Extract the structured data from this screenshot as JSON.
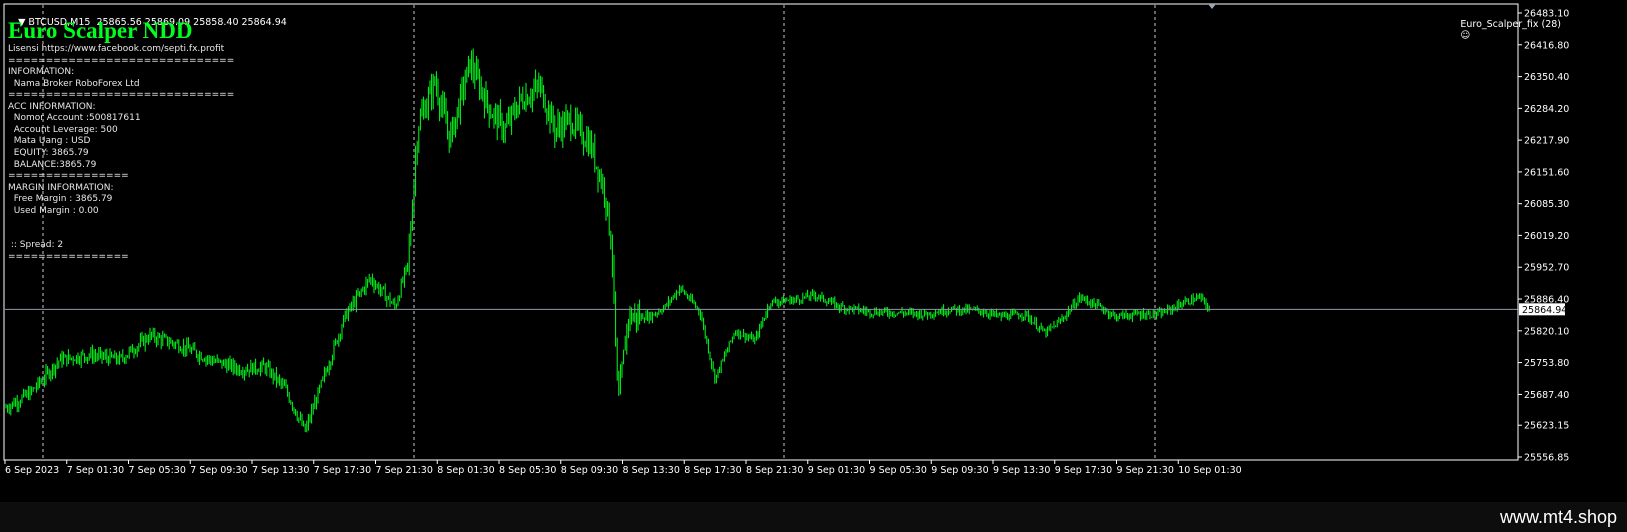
{
  "header": {
    "symbol_info": "BTCUSD,M15  25865.56 25869.09 25858.40 25864.94",
    "ea_label": "Euro_Scalper_fix (28)",
    "smile_icon": "smiley-icon"
  },
  "panel": {
    "title": "Euro Scalper NDD",
    "title_color": "#00ff1e",
    "lines": [
      "Lisensi https://www.facebook.com/septi.fx.profit",
      "==============================",
      "INFORMATION:",
      "  Nama Broker RoboForex Ltd",
      "==============================",
      "ACC INFORMATION:",
      "  Nomor Account :500817611",
      "  Account Leverage: 500",
      "  Mata Uang : USD",
      "  EQUITY: 3865.79",
      "  BALANCE:3865.79",
      "================",
      "MARGIN INFORMATION:",
      "  Free Margin : 3865.79",
      "  Used Margin : 0.00",
      "",
      "",
      " :: Spread: 2",
      "================"
    ]
  },
  "price_axis": {
    "labels": [
      "26483.10",
      "26416.80",
      "26350.40",
      "26284.20",
      "26217.90",
      "26151.60",
      "26085.30",
      "26019.20",
      "25952.70",
      "25886.40",
      "25820.10",
      "25753.80",
      "25687.40",
      "25623.15",
      "25556.85"
    ],
    "current_price": "25864.94"
  },
  "time_axis": {
    "labels": [
      "6 Sep 2023",
      "7 Sep 01:30",
      "7 Sep 05:30",
      "7 Sep 09:30",
      "7 Sep 13:30",
      "7 Sep 17:30",
      "7 Sep 21:30",
      "8 Sep 01:30",
      "8 Sep 05:30",
      "8 Sep 09:30",
      "8 Sep 13:30",
      "8 Sep 17:30",
      "8 Sep 21:30",
      "9 Sep 01:30",
      "9 Sep 05:30",
      "9 Sep 09:30",
      "9 Sep 13:30",
      "9 Sep 17:30",
      "9 Sep 21:30",
      "10 Sep 01:30"
    ]
  },
  "price_path": [
    [
      6,
      25660
    ],
    [
      30,
      25690
    ],
    [
      60,
      25760
    ],
    [
      90,
      25770
    ],
    [
      120,
      25760
    ],
    [
      150,
      25810
    ],
    [
      180,
      25790
    ],
    [
      210,
      25760
    ],
    [
      240,
      25740
    ],
    [
      265,
      25745
    ],
    [
      285,
      25700
    ],
    [
      305,
      25610
    ],
    [
      320,
      25700
    ],
    [
      345,
      25850
    ],
    [
      370,
      25930
    ],
    [
      395,
      25870
    ],
    [
      408,
      25960
    ],
    [
      418,
      26250
    ],
    [
      435,
      26340
    ],
    [
      450,
      26220
    ],
    [
      470,
      26380
    ],
    [
      490,
      26280
    ],
    [
      505,
      26240
    ],
    [
      520,
      26300
    ],
    [
      540,
      26330
    ],
    [
      555,
      26240
    ],
    [
      570,
      26260
    ],
    [
      590,
      26210
    ],
    [
      605,
      26110
    ],
    [
      612,
      25990
    ],
    [
      618,
      25660
    ],
    [
      628,
      25850
    ],
    [
      650,
      25850
    ],
    [
      665,
      25870
    ],
    [
      680,
      25910
    ],
    [
      700,
      25860
    ],
    [
      715,
      25720
    ],
    [
      735,
      25820
    ],
    [
      755,
      25800
    ],
    [
      770,
      25880
    ],
    [
      795,
      25885
    ],
    [
      815,
      25895
    ],
    [
      840,
      25870
    ],
    [
      870,
      25860
    ],
    [
      900,
      25858
    ],
    [
      925,
      25855
    ],
    [
      950,
      25865
    ],
    [
      980,
      25862
    ],
    [
      1000,
      25850
    ],
    [
      1025,
      25855
    ],
    [
      1045,
      25815
    ],
    [
      1060,
      25840
    ],
    [
      1080,
      25890
    ],
    [
      1100,
      25870
    ],
    [
      1115,
      25850
    ],
    [
      1140,
      25855
    ],
    [
      1160,
      25855
    ],
    [
      1185,
      25880
    ],
    [
      1200,
      25890
    ],
    [
      1210,
      25864
    ]
  ],
  "colors": {
    "candle": "#00ff1e",
    "grid_vline": "#c8c8c8",
    "current_price_line": "#8c9aa6",
    "axis_text": "#ffffff"
  },
  "watermark": "www.mt4.shop"
}
